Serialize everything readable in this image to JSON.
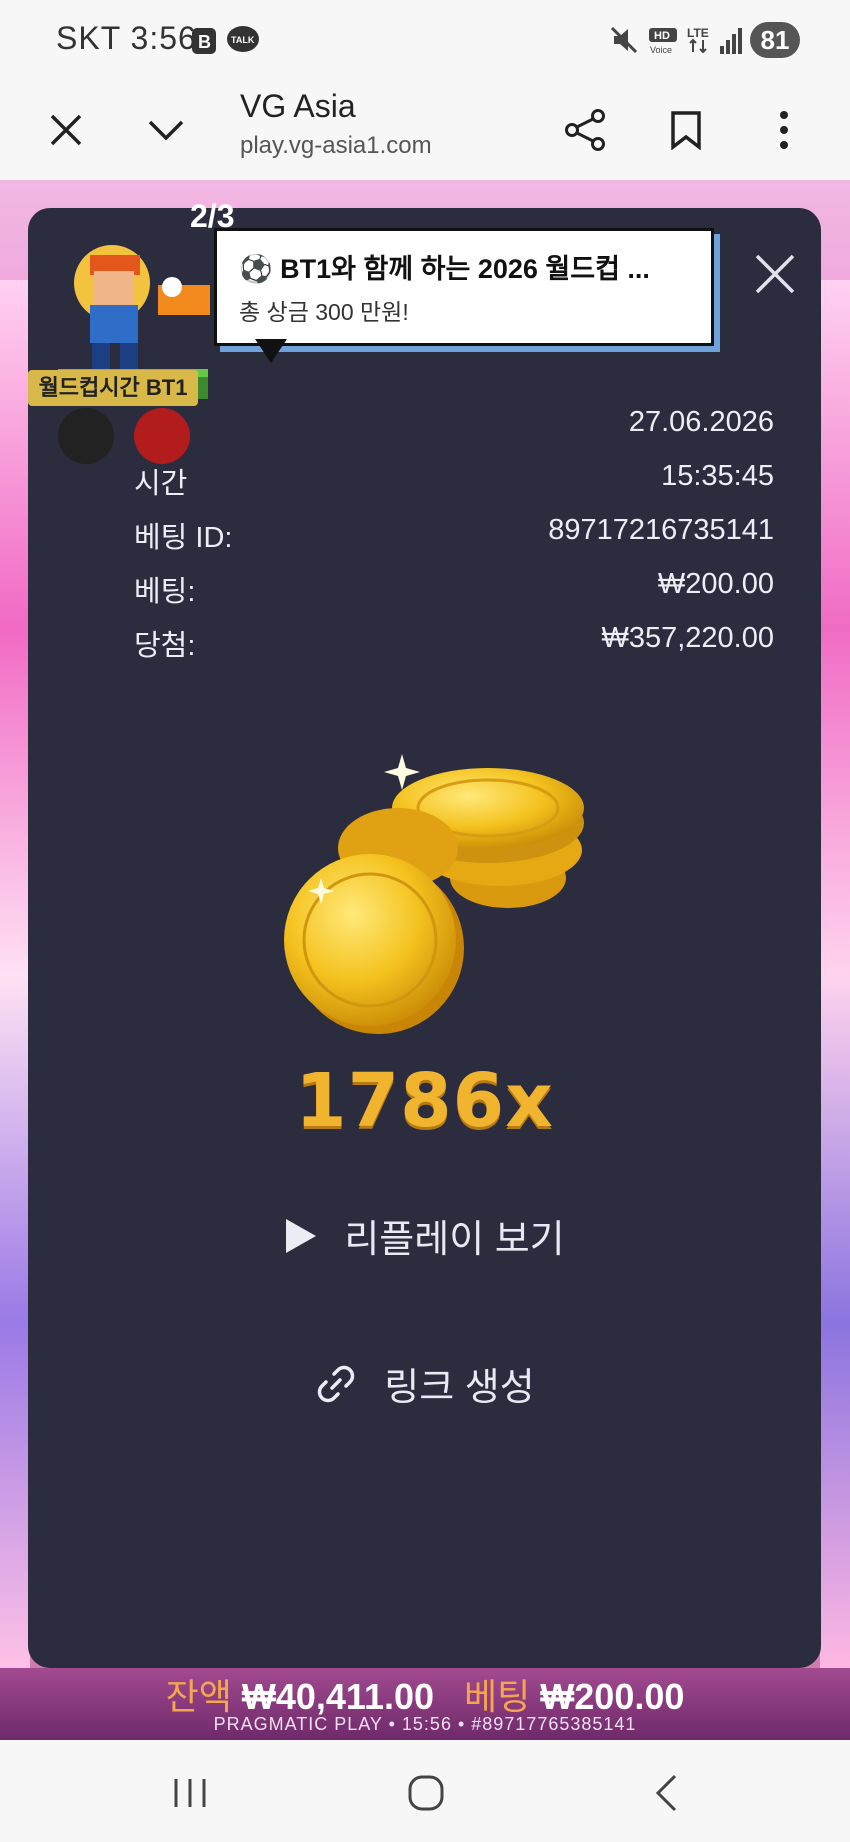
{
  "status": {
    "carrier": "SKT",
    "time": "3:56",
    "battery": "81"
  },
  "browser": {
    "title": "VG Asia",
    "url": "play.vg-asia1.com"
  },
  "overlay": {
    "pager": "2/3",
    "worldcup_label": "월드컵시간 BT1",
    "bubble_title": "⚽ BT1와 함께 하는 2026 월드컵 ...",
    "bubble_sub": "총 상금 300 만원!"
  },
  "bet": {
    "rows": [
      {
        "label": "",
        "value": "27.06.2026"
      },
      {
        "label": "시간",
        "value": "15:35:45"
      },
      {
        "label": "베팅 ID:",
        "value": "89717216735141"
      },
      {
        "label": "베팅:",
        "value": "₩200.00"
      },
      {
        "label": "당첨:",
        "value": "₩357,220.00"
      }
    ],
    "multiplier": "1786x",
    "replay_label": "리플레이 보기",
    "link_label": "링크 생성"
  },
  "game_footer": {
    "balance_label": "잔액",
    "balance": "₩40,411.00",
    "bet_label": "베팅",
    "bet": "₩200.00",
    "info": "PRAGMATIC PLAY • 15:56 • #89717765385141"
  },
  "colors": {
    "panel": "#2b2c3d",
    "gold": "#f0b42e",
    "accent_orange": "#f6a54f"
  }
}
